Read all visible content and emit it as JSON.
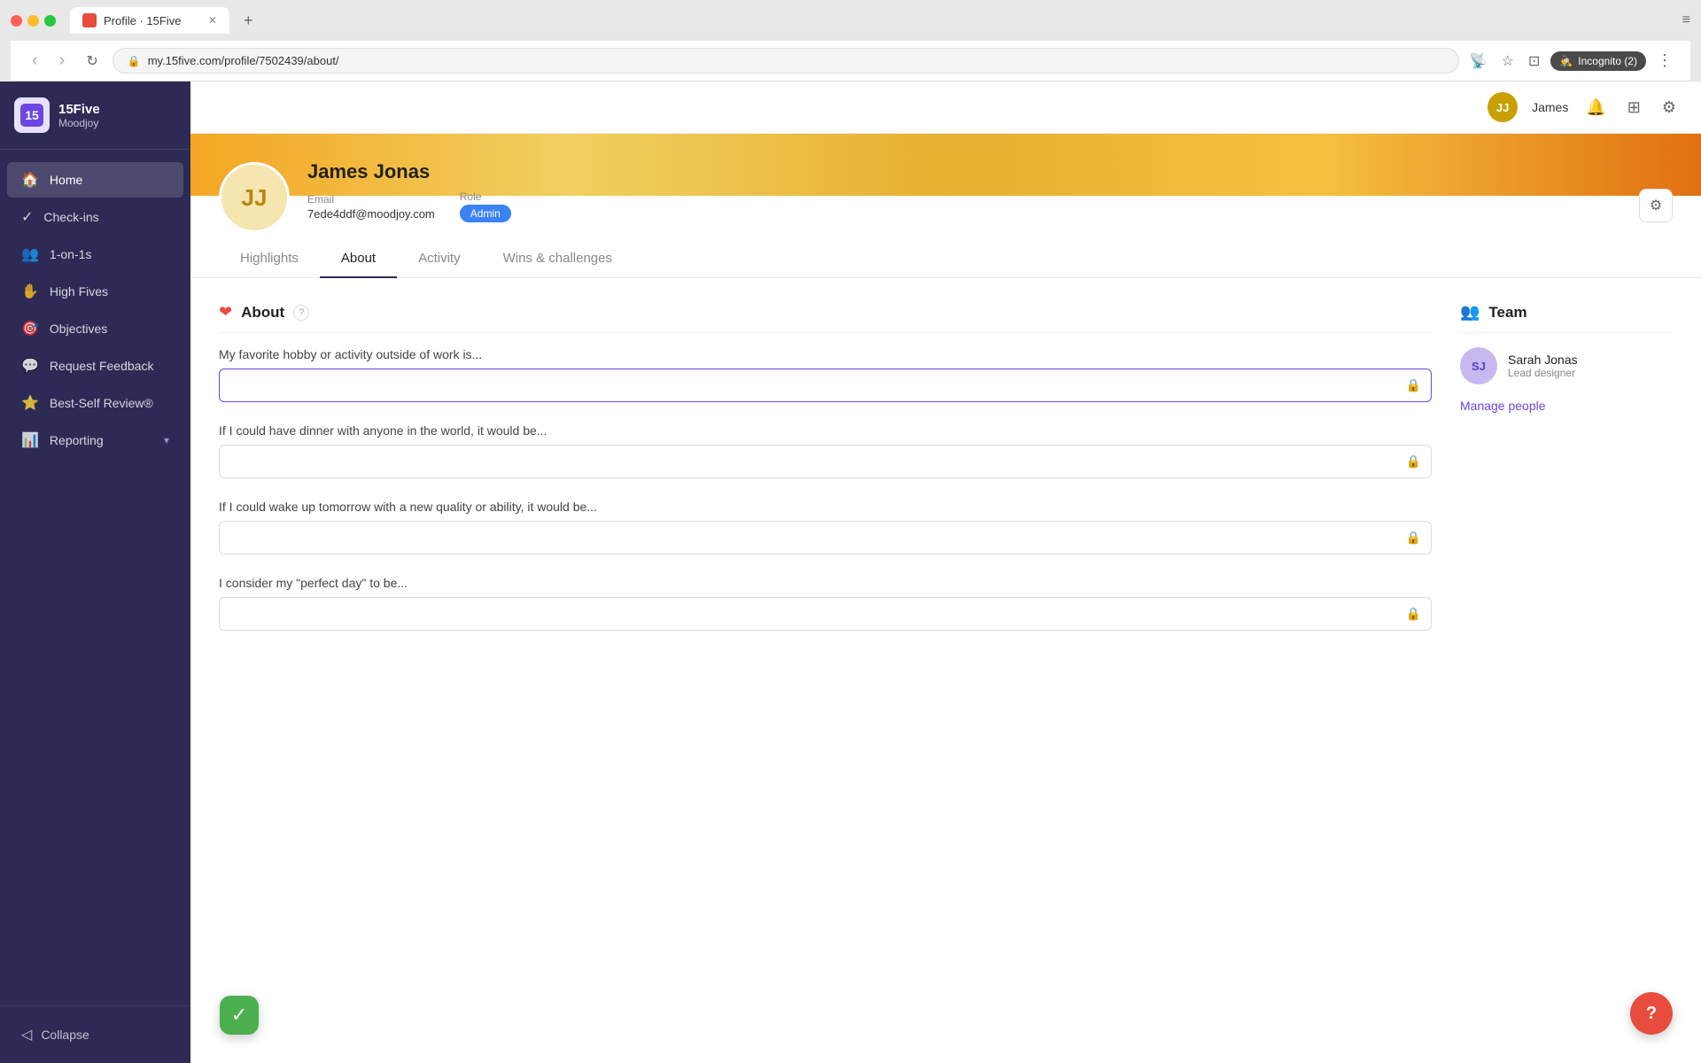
{
  "browser": {
    "tab_title": "Profile · 15Five",
    "url": "my.15five.com/profile/7502439/about/",
    "tab_new_label": "+",
    "nav_back": "‹",
    "nav_forward": "›",
    "nav_refresh": "↻",
    "incognito_label": "Incognito (2)"
  },
  "sidebar": {
    "app_name": "15Five",
    "app_sub": "Moodjoy",
    "items": [
      {
        "id": "home",
        "label": "Home",
        "icon": "🏠",
        "active": true
      },
      {
        "id": "checkins",
        "label": "Check-ins",
        "icon": "✓"
      },
      {
        "id": "1on1s",
        "label": "1-on-1s",
        "icon": "👥"
      },
      {
        "id": "highfives",
        "label": "High Fives",
        "icon": "✋"
      },
      {
        "id": "objectives",
        "label": "Objectives",
        "icon": "🎯"
      },
      {
        "id": "requestfeedback",
        "label": "Request Feedback",
        "icon": "💬"
      },
      {
        "id": "bestself",
        "label": "Best-Self Review®",
        "icon": "⭐"
      },
      {
        "id": "reporting",
        "label": "Reporting",
        "icon": "📊",
        "has_arrow": true
      }
    ],
    "collapse_label": "Collapse"
  },
  "header": {
    "avatar_initials": "JJ",
    "user_name": "James"
  },
  "profile": {
    "avatar_initials": "JJ",
    "name": "James Jonas",
    "email_label": "Email",
    "email_value": "7ede4ddf@moodjoy.com",
    "role_label": "Role",
    "role_value": "Admin",
    "tabs": [
      {
        "id": "highlights",
        "label": "Highlights"
      },
      {
        "id": "about",
        "label": "About",
        "active": true
      },
      {
        "id": "activity",
        "label": "Activity"
      },
      {
        "id": "wins",
        "label": "Wins & challenges"
      }
    ]
  },
  "about": {
    "section_title": "About",
    "help_tooltip": "?",
    "questions": [
      {
        "id": "q1",
        "label": "My favorite hobby or activity outside of work is...",
        "value": "",
        "active": true
      },
      {
        "id": "q2",
        "label": "If I could have dinner with anyone in the world, it would be...",
        "value": "",
        "active": false
      },
      {
        "id": "q3",
        "label": "If I could wake up tomorrow with a new quality or ability, it would be...",
        "value": "",
        "active": false
      },
      {
        "id": "q4",
        "label": "I consider my \"perfect day\" to be...",
        "value": "",
        "active": false
      }
    ]
  },
  "team": {
    "section_title": "Team",
    "members": [
      {
        "initials": "SJ",
        "name": "Sarah Jonas",
        "role": "Lead designer"
      }
    ],
    "manage_people_label": "Manage people"
  },
  "help_fab": "?",
  "check_badge": "✓"
}
